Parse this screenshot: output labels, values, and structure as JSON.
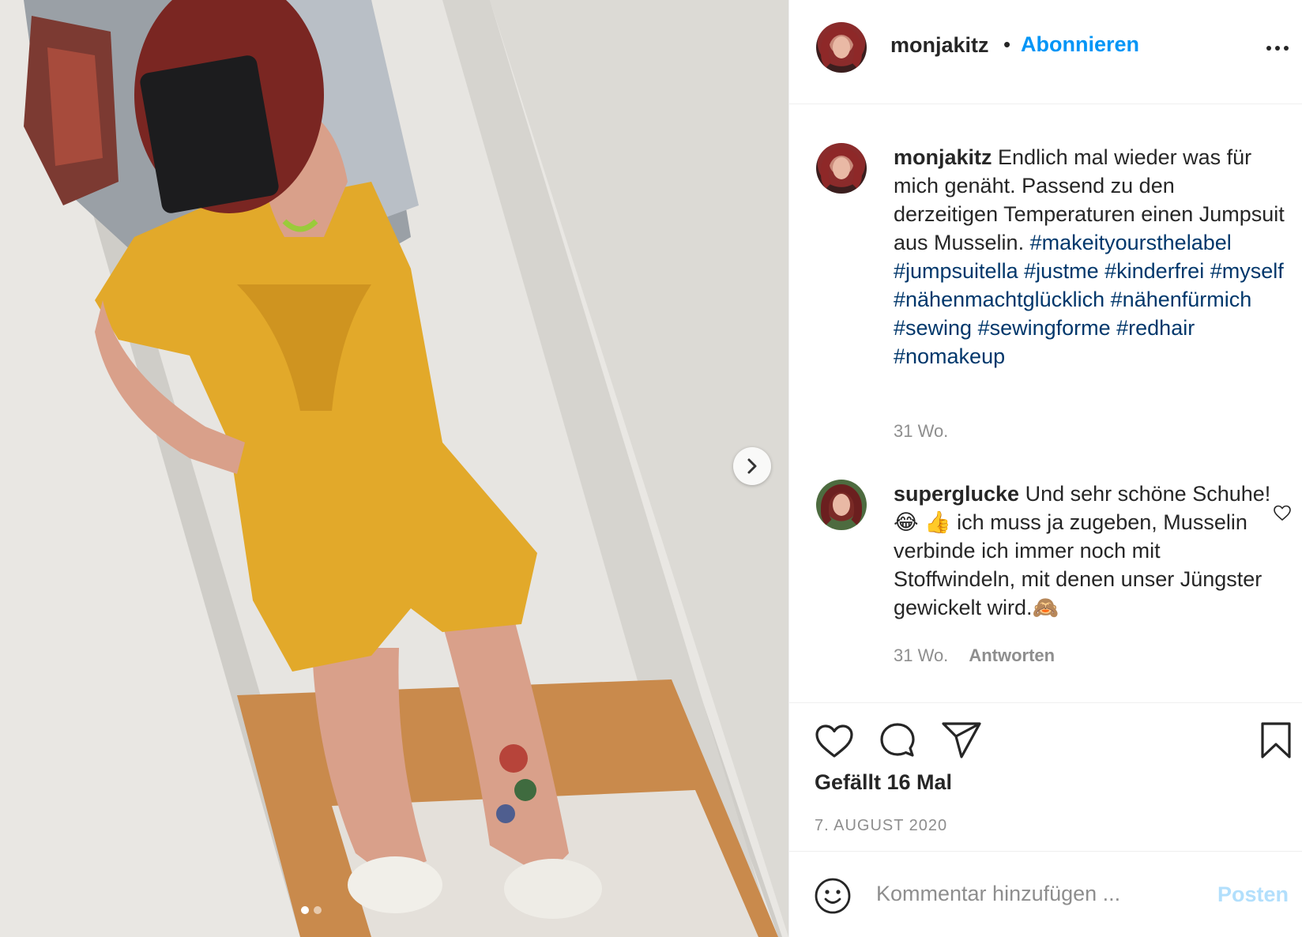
{
  "post": {
    "username": "monjakitz",
    "follow_separator": "•",
    "follow_label": "Abonnieren",
    "more_icon": "more-options-icon"
  },
  "caption": {
    "author": "monjakitz",
    "text": "Endlich mal wieder was für mich genäht. Passend zu den derzeitigen Temperaturen einen Jumpsuit aus Musselin.",
    "hashtags": "#makeityoursthelabel #jumpsuitella #justme #kinderfrei #myself #nähenmachtglücklich #nähenfürmich #sewing #sewingforme #redhair #nomakeup",
    "time": "31 Wo."
  },
  "comment": {
    "author": "superglucke",
    "text": "Und sehr schöne Schuhe!😂 👍 ich muss ja zugeben, Musselin verbinde ich immer noch mit Stoffwindeln, mit denen unser Jüngster gewickelt wird.🙈",
    "time": "31 Wo.",
    "reply_label": "Antworten"
  },
  "actions": {
    "like_icon": "heart-icon",
    "comment_icon": "comment-bubble-icon",
    "share_icon": "paper-plane-icon",
    "save_icon": "bookmark-icon",
    "likes_text": "Gefällt 16 Mal",
    "date": "7. AUGUST 2020"
  },
  "add_comment": {
    "placeholder": "Kommentar hinzufügen ...",
    "post_label": "Posten"
  },
  "carousel": {
    "slide_count": 2,
    "active_index": 0
  },
  "colors": {
    "link_blue": "#0095f6",
    "hashtag_blue": "#00376b",
    "muted_gray": "#8e8e8e",
    "post_disabled": "#b2dffc",
    "jumpsuit_yellow": "#e2a92a"
  }
}
